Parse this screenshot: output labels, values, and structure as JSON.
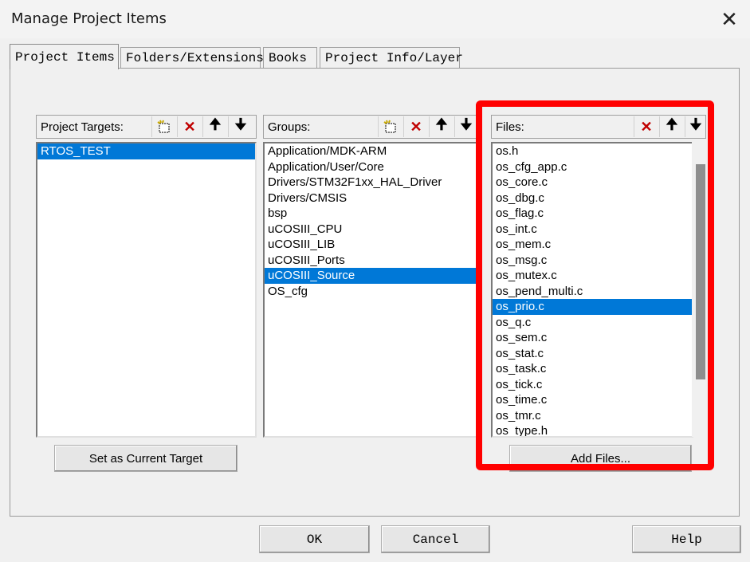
{
  "window": {
    "title": "Manage Project Items",
    "close_icon": "close-icon"
  },
  "tabs": [
    {
      "label": "Project Items",
      "active": true
    },
    {
      "label": "Folders/Extensions",
      "active": false
    },
    {
      "label": "Books",
      "active": false
    },
    {
      "label": "Project Info/Layer",
      "active": false
    }
  ],
  "targets": {
    "label": "Project Targets:",
    "items": [
      "RTOS_TEST"
    ],
    "selected": 0,
    "set_current_label": "Set as Current Target"
  },
  "groups": {
    "label": "Groups:",
    "items": [
      "Application/MDK-ARM",
      "Application/User/Core",
      "Drivers/STM32F1xx_HAL_Driver",
      "Drivers/CMSIS",
      "bsp",
      "uCOSIII_CPU",
      "uCOSIII_LIB",
      "uCOSIII_Ports",
      "uCOSIII_Source",
      "OS_cfg"
    ],
    "selected": 8
  },
  "files": {
    "label": "Files:",
    "items": [
      "os.h",
      "os_cfg_app.c",
      "os_core.c",
      "os_dbg.c",
      "os_flag.c",
      "os_int.c",
      "os_mem.c",
      "os_msg.c",
      "os_mutex.c",
      "os_pend_multi.c",
      "os_prio.c",
      "os_q.c",
      "os_sem.c",
      "os_stat.c",
      "os_task.c",
      "os_tick.c",
      "os_time.c",
      "os_tmr.c",
      "os_type.h"
    ],
    "selected": 10,
    "add_files_label": "Add Files..."
  },
  "footer": {
    "ok_label": "OK",
    "cancel_label": "Cancel",
    "help_label": "Help"
  },
  "colors": {
    "selection": "#0078d7",
    "highlight_box": "#ff0000"
  }
}
